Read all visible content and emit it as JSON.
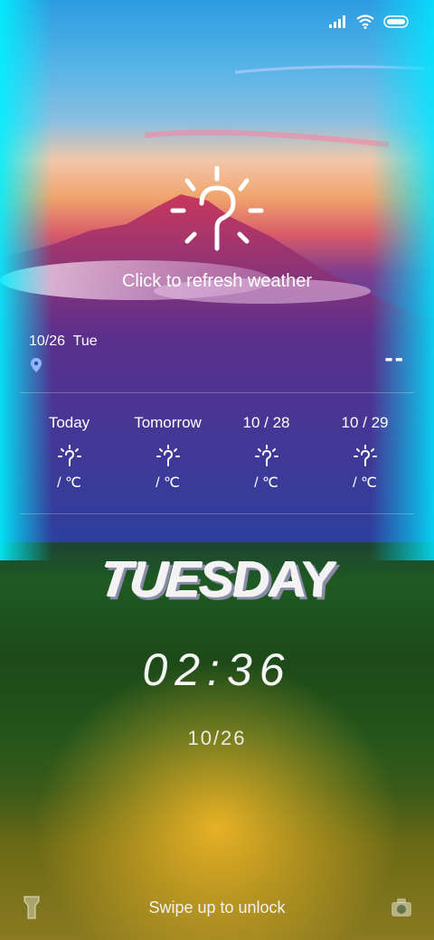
{
  "status": {
    "icons": [
      "signal-icon",
      "wifi-icon",
      "battery-icon"
    ]
  },
  "weather": {
    "refresh_text": "Click to refresh weather",
    "date": "10/26  Tue",
    "current_temp": "--",
    "forecast": [
      {
        "label": "Today",
        "temp": "/ ℃"
      },
      {
        "label": "Tomorrow",
        "temp": "/ ℃"
      },
      {
        "label": "10 / 28",
        "temp": "/ ℃"
      },
      {
        "label": "10 / 29",
        "temp": "/ ℃"
      }
    ]
  },
  "clock": {
    "day": "TUESDAY",
    "time": "02:36",
    "date": "10/26"
  },
  "bottom": {
    "unlock_text": "Swipe up to unlock"
  }
}
